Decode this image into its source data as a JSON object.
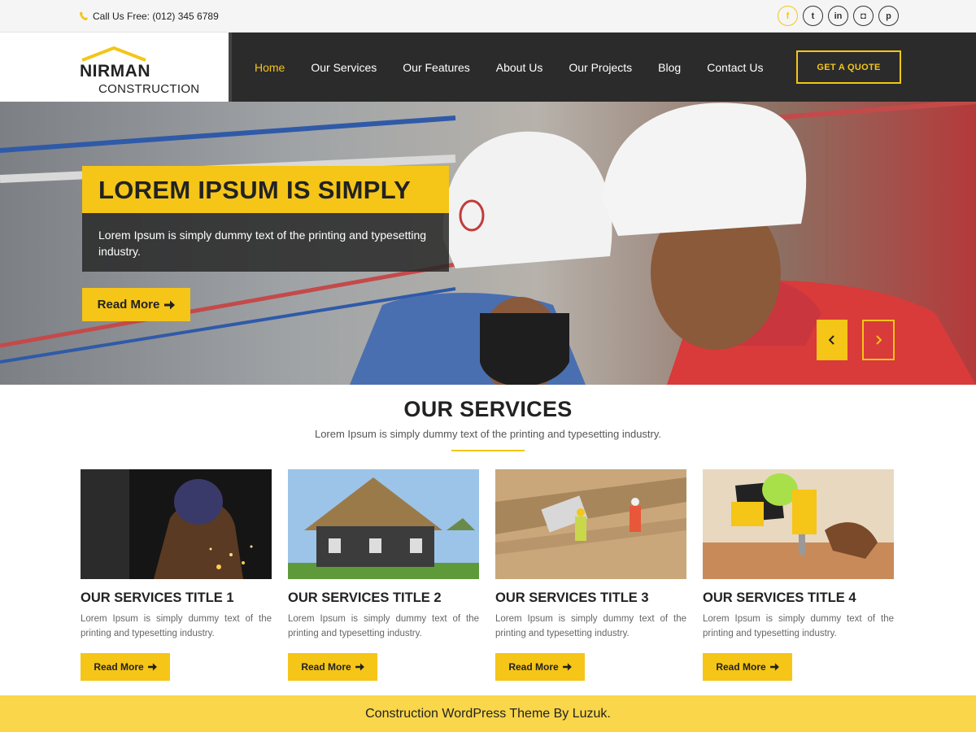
{
  "topbar": {
    "phone_text": "Call Us Free: (012) 345 6789",
    "socials": [
      "facebook-icon",
      "twitter-icon",
      "linkedin-icon",
      "instagram-icon",
      "pinterest-icon"
    ],
    "social_glyphs": [
      "f",
      "t",
      "in",
      "◘",
      "p"
    ]
  },
  "logo": {
    "top": "NIRMAN",
    "bottom": "CONSTRUCTION"
  },
  "nav": {
    "items": [
      "Home",
      "Our Services",
      "Our Features",
      "About Us",
      "Our Projects",
      "Blog",
      "Contact Us"
    ],
    "active": "Home",
    "quote_label": "GET A QUOTE"
  },
  "hero": {
    "title": "LOREM IPSUM IS SIMPLY",
    "description": "Lorem Ipsum is simply dummy text of the printing and typesetting industry.",
    "button_label": "Read More"
  },
  "services": {
    "heading": "OUR SERVICES",
    "subheading": "Lorem Ipsum is simply dummy text of the printing and typesetting industry.",
    "cards": [
      {
        "title": "OUR SERVICES TITLE 1",
        "text": "Lorem Ipsum is simply dummy text of the printing and typesetting industry.",
        "button": "Read More"
      },
      {
        "title": "OUR SERVICES TITLE 2",
        "text": "Lorem Ipsum is simply dummy text of the printing and typesetting industry.",
        "button": "Read More"
      },
      {
        "title": "OUR SERVICES TITLE 3",
        "text": "Lorem Ipsum is simply dummy text of the printing and typesetting industry.",
        "button": "Read More"
      },
      {
        "title": "OUR SERVICES TITLE 4",
        "text": "Lorem Ipsum is simply dummy text of the printing and typesetting industry.",
        "button": "Read More"
      }
    ]
  },
  "footer": {
    "text": "Construction WordPress Theme By Luzuk."
  },
  "colors": {
    "accent": "#f5c518",
    "dark": "#2b2b2b",
    "footer_bg": "#f9d64a"
  }
}
